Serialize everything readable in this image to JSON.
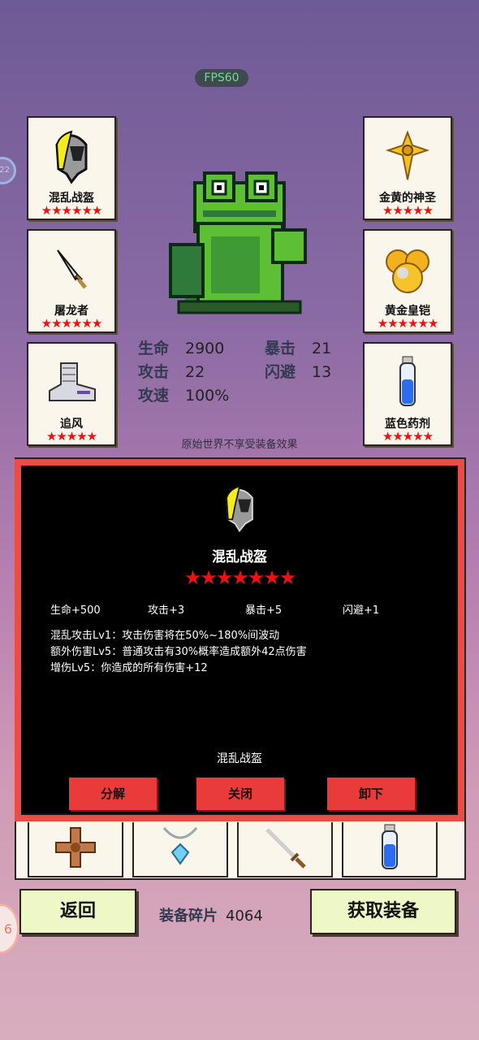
{
  "hud": {
    "fps": "FPS60",
    "side_badge": "22",
    "side_badge2": "6"
  },
  "equipment_left": [
    {
      "name": "混乱战盔",
      "stars": "★★★★★★",
      "icon": "helmet-icon"
    },
    {
      "name": "屠龙者",
      "stars": "★★★★★★",
      "icon": "dagger-icon"
    },
    {
      "name": "追风",
      "stars": "★★★★★",
      "icon": "boot-icon"
    }
  ],
  "equipment_right": [
    {
      "name": "金黄的神圣",
      "stars": "★★★★★",
      "icon": "golden-cross-icon"
    },
    {
      "name": "黄金皇铠",
      "stars": "★★★★★★",
      "icon": "golden-armor-icon"
    },
    {
      "name": "蓝色药剂",
      "stars": "★★★★★",
      "icon": "blue-potion-icon"
    }
  ],
  "stats": {
    "hp_label": "生命",
    "hp": "2900",
    "crit_label": "暴击",
    "crit": "21",
    "atk_label": "攻击",
    "atk": "22",
    "dodge_label": "闪避",
    "dodge": "13",
    "spd_label": "攻速",
    "spd": "100%"
  },
  "note": "原始世界不享受装备效果",
  "popup": {
    "title": "混乱战盔",
    "stars": "★★★★★★★",
    "attrs": [
      "生命+500",
      "攻击+3",
      "暴击+5",
      "闪避+1"
    ],
    "skills": [
      "混乱攻击Lv1：攻击伤害将在50%~180%间波动",
      "额外伤害Lv5：普通攻击有30%概率造成额外42点伤害",
      "增伤Lv5：你造成的所有伤害+12"
    ],
    "subtitle": "混乱战盔",
    "btn_decompose": "分解",
    "btn_close": "关闭",
    "btn_unequip": "卸下"
  },
  "bottom_items": [
    "bronze-cross-icon",
    "crystal-necklace-icon",
    "sword-icon",
    "potion-icon"
  ],
  "footer": {
    "back": "返回",
    "shards_label": "装备碎片",
    "shards_value": "4064",
    "get_equipment": "获取装备"
  },
  "colors": {
    "accent_red": "#ea4d45",
    "star_red": "#e11111",
    "card_bg": "#fbf6ec"
  }
}
